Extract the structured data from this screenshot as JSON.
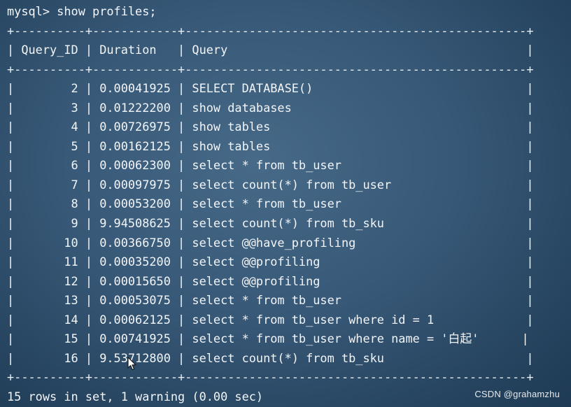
{
  "terminal": {
    "prompt": "mysql> show profiles;",
    "border": "+----------+------------+------------------------------------------------+",
    "header": "| Query_ID | Duration   | Query                                          |",
    "rows": [
      {
        "text": "|        2 | 0.00041925 | SELECT DATABASE()                              |"
      },
      {
        "text": "|        3 | 0.01222200 | show databases                                 |"
      },
      {
        "text": "|        4 | 0.00726975 | show tables                                    |"
      },
      {
        "text": "|        5 | 0.00162125 | show tables                                    |"
      },
      {
        "text": "|        6 | 0.00062300 | select * from tb_user                          |"
      },
      {
        "text": "|        7 | 0.00097975 | select count(*) from tb_user                   |"
      },
      {
        "text": "|        8 | 0.00053200 | select * from tb_user                          |"
      },
      {
        "text": "|        9 | 9.94508625 | select count(*) from tb_sku                    |"
      },
      {
        "text": "|       10 | 0.00366750 | select @@have_profiling                        |"
      },
      {
        "text": "|       11 | 0.00035200 | select @@profiling                             |"
      },
      {
        "text": "|       12 | 0.00015650 | select @@profiling                             |"
      },
      {
        "text": "|       13 | 0.00053075 | select * from tb_user                          |"
      },
      {
        "text": "|       14 | 0.00062125 | select * from tb_user where id = 1             |"
      },
      {
        "text": "|       15 | 0.00741925 | select * from tb_user where name = '白起'      |"
      },
      {
        "text": "|       16 | 9.53712800 | select count(*) from tb_sku                    |"
      }
    ],
    "summary": "15 rows in set, 1 warning (0.00 sec)"
  },
  "watermark": "CSDN @grahamzhu",
  "cursor_icon": "mouse-pointer-icon",
  "colors": {
    "background": "#375877",
    "text": "#f2f5f8"
  }
}
